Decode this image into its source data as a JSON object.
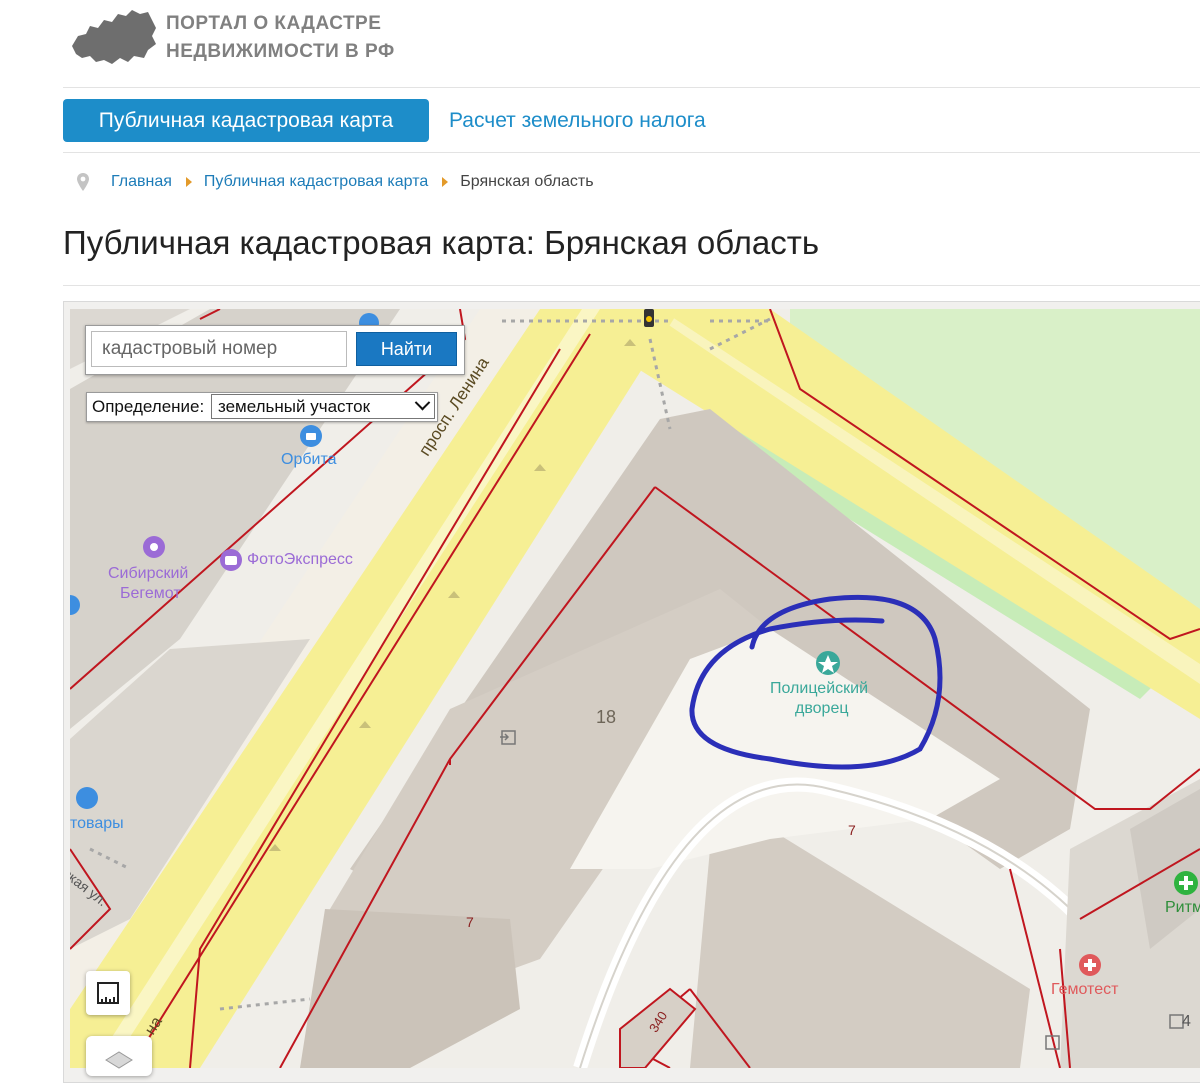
{
  "header": {
    "logo_line1": "ПОРТАЛ О КАДАСТРЕ",
    "logo_line2": "НЕДВИЖИМОСТИ В РФ"
  },
  "nav": {
    "active_tab": "Публичная кадастровая карта",
    "tab_tax": "Расчет земельного налога"
  },
  "breadcrumb": {
    "home": "Главная",
    "section": "Публичная кадастровая карта",
    "current": "Брянская область"
  },
  "page_title": "Публичная кадастровая карта: Брянская область",
  "search": {
    "placeholder": "кадастровый номер",
    "button": "Найти"
  },
  "definition": {
    "label": "Определение:",
    "selected": "земельный участок"
  },
  "map_labels": {
    "street_lenina": "просп. Ленина",
    "orbita": "Орбита",
    "photoexpress": "ФотоЭкспресс",
    "siberian_1": "Сибирский",
    "siberian_2": "Бегемот",
    "police_1": "Полицейский",
    "police_2": "дворец",
    "house_18": "18",
    "house_7a": "7",
    "house_7b": "7",
    "tovary": "товары",
    "street_skaya": "ская ул.",
    "gemotest": "Гемотест",
    "ritm": "Ритм",
    "plot_340": "340",
    "house_4": "4",
    "street_na": "на"
  },
  "colors": {
    "brand_blue": "#1d8dc9",
    "annotation": "#2b2fb8",
    "cadastral_line": "#c0161f",
    "poi_purple": "#9b6bd6",
    "poi_blue": "#3d8ee0",
    "poi_green": "#3aa89a"
  }
}
